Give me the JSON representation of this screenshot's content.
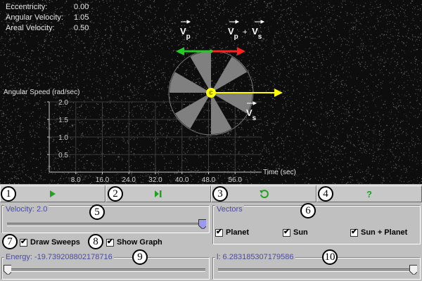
{
  "info": [
    {
      "label": "Eccentricity:",
      "value": "0.00"
    },
    {
      "label": "Angular Velocity:",
      "value": "1.05"
    },
    {
      "label": "Areal Velocity:",
      "value": "0.50"
    }
  ],
  "vector_labels": {
    "vp": {
      "main": "V",
      "sub": "p"
    },
    "vp_plus_vs": {
      "a_main": "V",
      "a_sub": "p",
      "plus": "+",
      "b_main": "V",
      "b_sub": "s"
    },
    "vs": {
      "main": "V",
      "sub": "s"
    }
  },
  "chart_data": {
    "type": "line",
    "ylabel": "Angular Speed (rad/sec)",
    "xlabel": "Time (sec)",
    "y_ticks": [
      "2.0",
      "1.5",
      "1.0",
      "0.5"
    ],
    "x_ticks": [
      "8.0",
      "16.0",
      "24.0",
      "32.0",
      "40.0",
      "48.0",
      "56.0"
    ],
    "xlim": [
      0,
      64
    ],
    "ylim": [
      0,
      2.0
    ],
    "series": []
  },
  "toolbar": {
    "play_icon": "play-icon",
    "step_icon": "step-forward-icon",
    "reset_icon": "reset-icon",
    "help_icon": "help-icon",
    "help_glyph": "?"
  },
  "markers": [
    "1",
    "2",
    "3",
    "4",
    "5",
    "6",
    "7",
    "8",
    "9",
    "10"
  ],
  "velocity": {
    "label": "Velocity: 2.0",
    "level": 1.0
  },
  "vectors": {
    "title": "Vectors",
    "planet": {
      "label": "Planet",
      "checked": true
    },
    "sun": {
      "label": "Sun",
      "checked": true
    },
    "sun_plus_planet": {
      "label": "Sun + Planet",
      "checked": true
    }
  },
  "draw_sweeps": {
    "label": "Draw Sweeps",
    "checked": true
  },
  "show_graph": {
    "label": "Show Graph",
    "checked": true
  },
  "energy": {
    "label": "Energy: -19.739208802178716",
    "level": 0.0
  },
  "l": {
    "label": "l: 6.283185307179586",
    "level": 1.0
  },
  "colors": {
    "vp": "#22cc22",
    "vs": "#ffff00",
    "sum": "#ff2020",
    "sweep": "#808080",
    "title": "#4b4b9a",
    "toolbar_icon": "#1fa31f"
  }
}
